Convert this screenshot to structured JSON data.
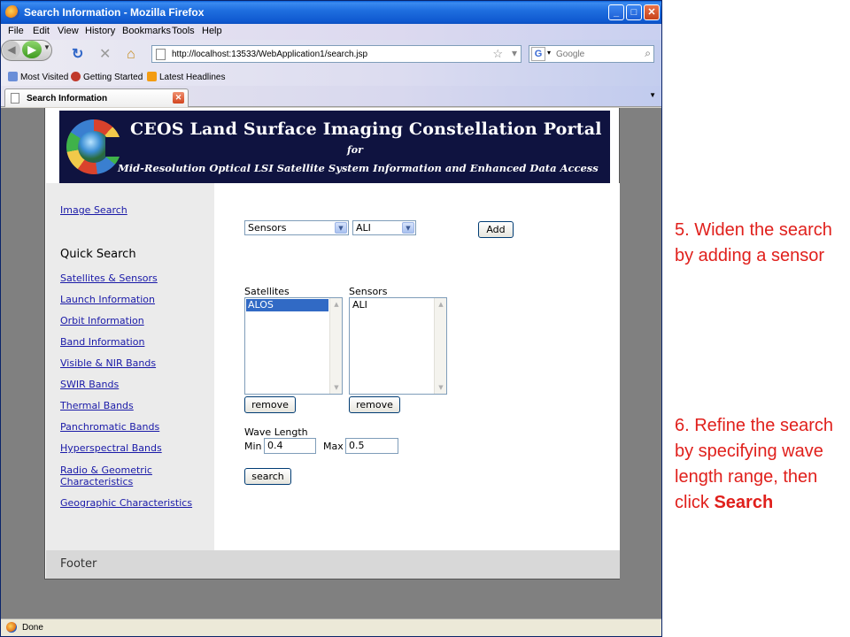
{
  "browser": {
    "title": "Search Information - Mozilla Firefox",
    "menu": [
      "File",
      "Edit",
      "View",
      "History",
      "Bookmarks",
      "Tools",
      "Help"
    ],
    "url": "http://localhost:13533/WebApplication1/search.jsp",
    "search_placeholder": "Google",
    "search_engine_letter": "G",
    "bookmarks": [
      "Most Visited",
      "Getting Started",
      "Latest Headlines"
    ],
    "tab_title": "Search Information",
    "status": "Done"
  },
  "banner": {
    "title": "CEOS Land Surface Imaging Constellation Portal",
    "for": "for",
    "subtitle": "Mid-Resolution Optical LSI Satellite System Information and Enhanced Data Access"
  },
  "sidebar": {
    "image_search": "Image Search",
    "quick_search_heading": "Quick Search",
    "links": [
      "Satellites & Sensors",
      "Launch Information",
      "Orbit Information",
      "Band Information",
      "Visible & NIR Bands",
      "SWIR Bands",
      "Thermal Bands",
      "Panchromatic Bands",
      "Hyperspectral Bands",
      "Radio & Geometric",
      "Characteristics",
      "Geographic Characteristics"
    ]
  },
  "form": {
    "category_select": "Sensors",
    "value_select": "ALI",
    "add_label": "Add",
    "satellites_label": "Satellites",
    "sensors_label": "Sensors",
    "satellites_items": [
      "ALOS"
    ],
    "sensors_items": [
      "ALI"
    ],
    "remove_label": "remove",
    "wave_length_label": "Wave Length",
    "min_label": "Min",
    "min_value": "0.4",
    "max_label": "Max",
    "max_value": "0.5",
    "search_label": "search"
  },
  "footer": "Footer",
  "annotations": {
    "step5": "5. Widen the search by adding a sensor",
    "step6_text": "6. Refine the search by specifying wave length range, then click",
    "step6_bold": "Search"
  }
}
